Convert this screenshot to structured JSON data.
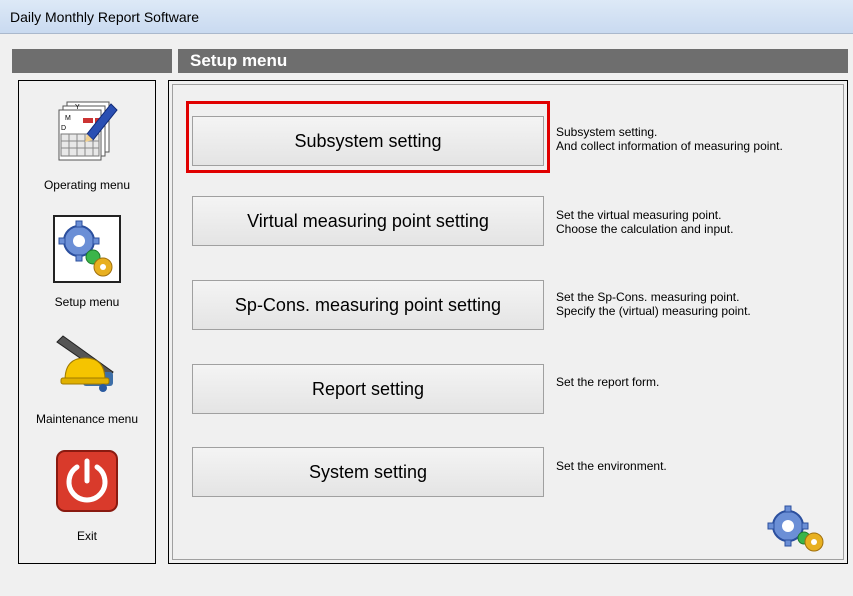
{
  "window": {
    "title": "Daily Monthly Report Software"
  },
  "header": {
    "title": "Setup menu"
  },
  "sidebar": {
    "items": [
      {
        "label": "Operating menu",
        "icon": "calendar-pen-icon"
      },
      {
        "label": "Setup menu",
        "icon": "gears-icon",
        "active": true
      },
      {
        "label": "Maintenance menu",
        "icon": "hardhat-tools-icon"
      },
      {
        "label": "Exit",
        "icon": "power-icon"
      }
    ]
  },
  "menu": {
    "items": [
      {
        "label": "Subsystem setting",
        "desc1": "Subsystem setting.",
        "desc2": "And collect information of measuring point.",
        "highlighted": true
      },
      {
        "label": "Virtual measuring point setting",
        "desc1": "Set the virtual measuring point.",
        "desc2": "Choose the calculation and input."
      },
      {
        "label": "Sp-Cons. measuring point setting",
        "desc1": "Set the Sp-Cons. measuring point.",
        "desc2": "Specify the (virtual) measuring point."
      },
      {
        "label": "Report setting",
        "desc1": "Set the report form.",
        "desc2": ""
      },
      {
        "label": "System setting",
        "desc1": "Set the environment.",
        "desc2": ""
      }
    ]
  },
  "colors": {
    "highlight": "#e00000",
    "header_bar": "#6e6e6e",
    "exit_red": "#d93a2b"
  }
}
